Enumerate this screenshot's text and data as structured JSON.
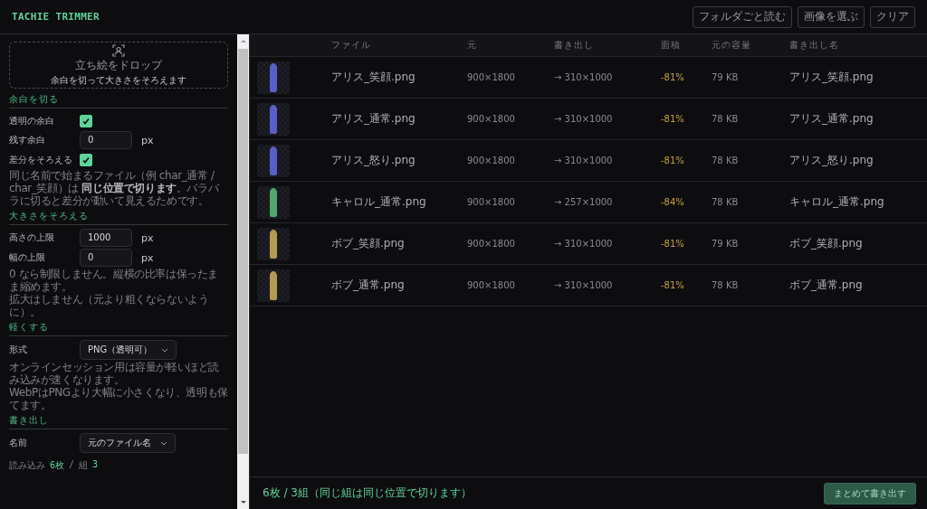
{
  "app_title": "TACHIE TRIMMER",
  "toolbar": [
    {
      "label": "フォルダごと読む"
    },
    {
      "label": "画像を選ぶ"
    },
    {
      "label": "クリア"
    }
  ],
  "drop_zone": {
    "title": "立ち絵をドロップ",
    "subtitle": "余白を切って大きさをそろえます"
  },
  "sections": [
    {
      "title": "余白を切る",
      "items": [
        {
          "kind": "checkbox",
          "label": "透明の余白",
          "checked": true
        },
        {
          "kind": "number",
          "label": "残す余白",
          "value": "0",
          "unit": "px"
        },
        {
          "kind": "checkbox",
          "label": "差分をそろえる",
          "checked": true
        },
        {
          "kind": "note",
          "lines": [
            "同じ名前で始まるファイル（例 char_通常 / char_笑顔）は **同じ位置で切ります**。バラバラに切ると差分が動いて見えるためです。"
          ]
        }
      ]
    },
    {
      "title": "大きさをそろえる",
      "items": [
        {
          "kind": "number",
          "label": "高さの上限",
          "value": "1000",
          "unit": "px"
        },
        {
          "kind": "number",
          "label": "幅の上限",
          "value": "0",
          "unit": "px"
        },
        {
          "kind": "note",
          "lines": [
            "0 なら制限しません。縦横の比率は保ったまま縮めます。",
            "拡大はしません（元より粗くならないように）。"
          ]
        }
      ]
    },
    {
      "title": "軽くする",
      "items": [
        {
          "kind": "select",
          "label": "形式",
          "value": "PNG（透明可）"
        },
        {
          "kind": "note",
          "lines": [
            "オンラインセッション用は容量が軽いほど読み込みが速くなります。",
            "WebPはPNGより大幅に小さくなり、透明も保てます。"
          ]
        }
      ]
    },
    {
      "title": "書き出し",
      "items": [
        {
          "kind": "select",
          "label": "名前",
          "value": "元のファイル名"
        }
      ]
    }
  ],
  "sidebar_status": {
    "loaded_label": "読み込み",
    "loaded_count": "6枚",
    "separator": "/",
    "group_label": "組",
    "group_count": "3"
  },
  "table": {
    "columns": [
      "ファイル",
      "元",
      "書き出し",
      "面積",
      "元の容量",
      "書き出し名"
    ],
    "rows": [
      {
        "color": "#5a5ec8",
        "file": "アリス_笑顔.png",
        "original": "900×1800",
        "output": "→ 310×1000",
        "area": "-81%",
        "size": "79 KB",
        "export_name": "アリス_笑顔.png"
      },
      {
        "color": "#5a5ec8",
        "file": "アリス_通常.png",
        "original": "900×1800",
        "output": "→ 310×1000",
        "area": "-81%",
        "size": "78 KB",
        "export_name": "アリス_通常.png"
      },
      {
        "color": "#5a5ec8",
        "file": "アリス_怒り.png",
        "original": "900×1800",
        "output": "→ 310×1000",
        "area": "-81%",
        "size": "78 KB",
        "export_name": "アリス_怒り.png"
      },
      {
        "color": "#4fa86a",
        "file": "キャロル_通常.png",
        "original": "900×1800",
        "output": "→ 257×1000",
        "area": "-84%",
        "size": "78 KB",
        "export_name": "キャロル_通常.png"
      },
      {
        "color": "#b59a52",
        "file": "ボブ_笑顔.png",
        "original": "900×1800",
        "output": "→ 310×1000",
        "area": "-81%",
        "size": "79 KB",
        "export_name": "ボブ_笑顔.png"
      },
      {
        "color": "#b59a52",
        "file": "ボブ_通常.png",
        "original": "900×1800",
        "output": "→ 310×1000",
        "area": "-81%",
        "size": "78 KB",
        "export_name": "ボブ_通常.png"
      }
    ]
  },
  "footer": {
    "summary": "6枚 / 3組（同じ組は同じ位置で切ります）",
    "export_button": "まとめて書き出す"
  }
}
